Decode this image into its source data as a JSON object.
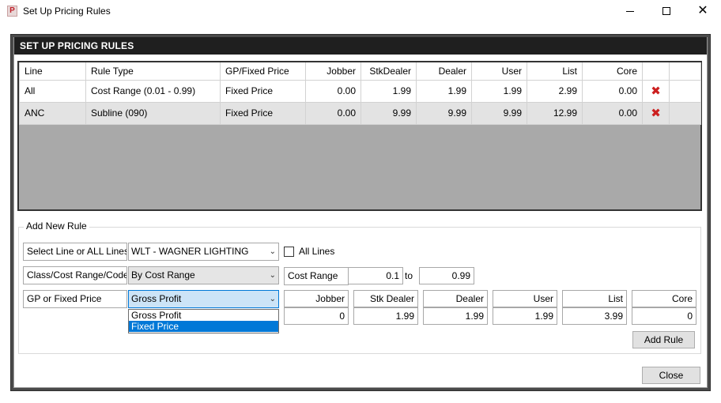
{
  "window": {
    "title": "Set Up Pricing Rules",
    "app_icon_letter": "P"
  },
  "panel": {
    "header": "SET UP PRICING RULES"
  },
  "grid": {
    "columns": [
      "Line",
      "Rule Type",
      "GP/Fixed Price",
      "Jobber",
      "StkDealer",
      "Dealer",
      "User",
      "List",
      "Core"
    ],
    "rows": [
      {
        "line": "All",
        "rule_type": "Cost Range (0.01 - 0.99)",
        "gp_fixed": "Fixed Price",
        "jobber": "0.00",
        "stkdealer": "1.99",
        "dealer": "1.99",
        "user": "1.99",
        "list": "2.99",
        "core": "0.00"
      },
      {
        "line": "ANC",
        "rule_type": "Subline (090)",
        "gp_fixed": "Fixed Price",
        "jobber": "0.00",
        "stkdealer": "9.99",
        "dealer": "9.99",
        "user": "9.99",
        "list": "12.99",
        "core": "0.00"
      }
    ],
    "delete_icon": "delete-x-icon",
    "delete_color": "#cc1f1f"
  },
  "add_rule": {
    "legend": "Add New Rule",
    "line_label": "Select Line or ALL Lines",
    "line_value": "WLT - WAGNER LIGHTING",
    "all_lines_label": "All Lines",
    "all_lines_checked": false,
    "class_label": "Class/Cost Range/Code",
    "class_value": "By Cost Range",
    "cost_range_label": "Cost Range",
    "cost_from": "0.1",
    "to_label": "to",
    "cost_to": "0.99",
    "gp_label": "GP or Fixed Price",
    "gp_value": "Gross Profit",
    "gp_options": [
      "Gross Profit",
      "Fixed Price"
    ],
    "gp_highlighted": "Fixed Price",
    "price_headers": [
      "Jobber",
      "Stk Dealer",
      "Dealer",
      "User",
      "List",
      "Core"
    ],
    "price_values": [
      "0",
      "1.99",
      "1.99",
      "1.99",
      "3.99",
      "0"
    ],
    "add_button": "Add Rule"
  },
  "close_button": "Close",
  "colors": {
    "frame": "#4a4a4a",
    "header_bg": "#1f1f1f",
    "grid_empty": "#a9a9a9",
    "focus": "#cce4f7",
    "selection": "#0078d7"
  }
}
